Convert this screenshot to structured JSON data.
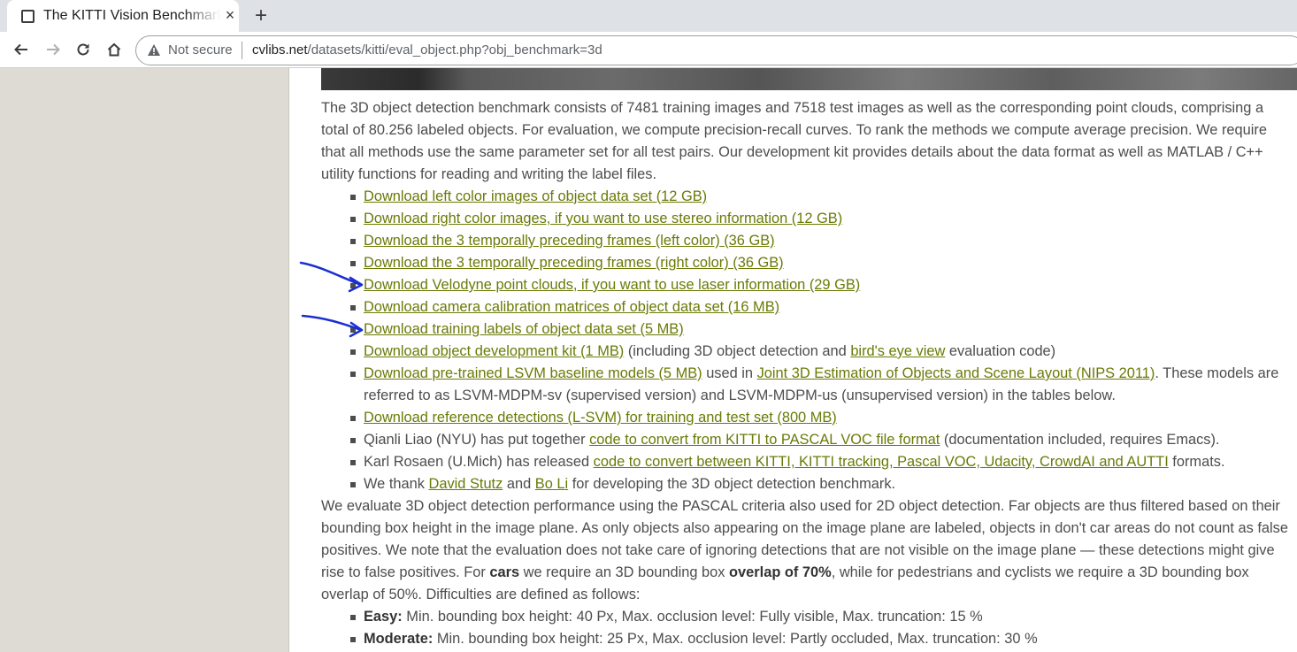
{
  "tab": {
    "title": "The KITTI Vision Benchmark Suite",
    "close": "×",
    "new_tab": "+"
  },
  "toolbar": {
    "security_label": "Not secure",
    "url_host": "cvlibs.net",
    "url_rest": "/datasets/kitti/eval_object.php?obj_benchmark=3d"
  },
  "intro": [
    "The 3D object detection benchmark consists of 7481 training images and 7518 test images as well as the corresponding point clouds, comprising a",
    "total of 80.256 labeled objects. For evaluation, we compute precision-recall curves. To rank the methods we compute average precision. We require",
    "that all methods use the same parameter set for all test pairs. Our development kit provides details about the data format as well as MATLAB / C++",
    "utility functions for reading and writing the label files."
  ],
  "downloads": [
    "Download left color images of object data set (12 GB)",
    "Download right color images, if you want to use stereo information (12 GB)",
    "Download the 3 temporally preceding frames (left color) (36 GB)",
    "Download the 3 temporally preceding frames (right color) (36 GB)",
    "Download Velodyne point clouds, if you want to use laser information (29 GB)",
    "Download camera calibration matrices of object data set (16 MB)",
    "Download training labels of object data set (5 MB)"
  ],
  "devkit": {
    "link": "Download object development kit (1 MB)",
    "t1": " (including 3D object detection and ",
    "link2": "bird's eye view",
    "t2": " evaluation code)"
  },
  "lsvm": {
    "link": "Download pre-trained LSVM baseline models (5 MB)",
    "t1": " used in ",
    "link2": "Joint 3D Estimation of Objects and Scene Layout (NIPS 2011)",
    "t2": ". These models are",
    "line2": "referred to as LSVM-MDPM-sv (supervised version) and LSVM-MDPM-us (unsupervised version) in the tables below."
  },
  "refdet": {
    "link": "Download reference detections (L-SVM) for training and test set (800 MB)"
  },
  "qianli": {
    "t1": "Qianli Liao (NYU) has put together ",
    "link": "code to convert from KITTI to PASCAL VOC file format",
    "t2": " (documentation included, requires Emacs)."
  },
  "karl": {
    "t1": "Karl Rosaen (U.Mich) has released ",
    "link": "code to convert between KITTI, KITTI tracking, Pascal VOC, Udacity, CrowdAI and AUTTI",
    "t2": " formats."
  },
  "thanks": {
    "t1": "We thank ",
    "link1": "David Stutz",
    "t2": " and ",
    "link2": "Bo Li",
    "t3": " for developing the 3D object detection benchmark."
  },
  "eval": {
    "l1": "We evaluate 3D object detection performance using the PASCAL criteria also used for 2D object detection. Far objects are thus filtered based on their",
    "l2": "bounding box height in the image plane. As only objects also appearing on the image plane are labeled, objects in don't car areas do not count as false",
    "l3": "positives. We note that the evaluation does not take care of ignoring detections that are not visible on the image plane — these detections might give",
    "l4a": "rise to false positives. For ",
    "l4b": "cars",
    "l4c": " we require an 3D bounding box ",
    "l4d": "overlap of 70%",
    "l4e": ", while for pedestrians and cyclists we require a 3D bounding box",
    "l5": "overlap of 50%. Difficulties are defined as follows:"
  },
  "difficulties": [
    {
      "name": "Easy:",
      "text": " Min. bounding box height: 40 Px, Max. occlusion level: Fully visible, Max. truncation: 15 %"
    },
    {
      "name": "Moderate:",
      "text": " Min. bounding box height: 25 Px, Max. occlusion level: Partly occluded, Max. truncation: 30 %"
    }
  ],
  "colors": {
    "link": "#6b7a06",
    "text": "#4d4d4d",
    "annotation": "#1a2fd1",
    "sidebar": "#dddbd3"
  }
}
